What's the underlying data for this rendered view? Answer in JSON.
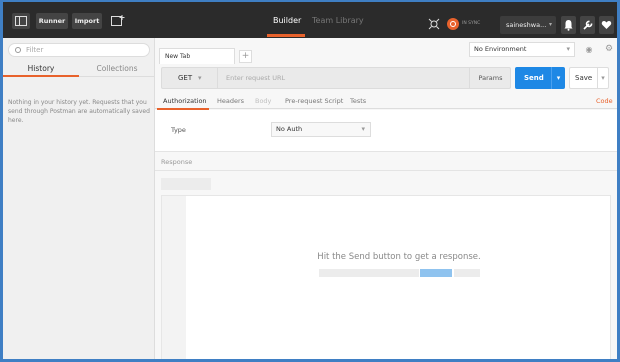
{
  "topbar": {
    "runner_label": "Runner",
    "import_label": "Import",
    "tabs": [
      {
        "label": "Builder",
        "active": true
      },
      {
        "label": "Team Library",
        "active": false
      }
    ],
    "sync_label": "IN SYNC",
    "username": "saineshwa...",
    "accent_color": "#e8622c"
  },
  "sidebar": {
    "filter_placeholder": "Filter",
    "tabs": [
      {
        "label": "History",
        "active": true
      },
      {
        "label": "Collections",
        "active": false
      }
    ],
    "empty_message": "Nothing in your history yet. Requests that you send through Postman are automatically saved here."
  },
  "main": {
    "request_tab_label": "New Tab",
    "add_tab_label": "+",
    "environment": "No Environment",
    "method": "GET",
    "url_placeholder": "Enter request URL",
    "params_label": "Params",
    "send_label": "Send",
    "save_label": "Save",
    "subtabs": [
      {
        "label": "Authorization",
        "state": "active"
      },
      {
        "label": "Headers",
        "state": "normal"
      },
      {
        "label": "Body",
        "state": "disabled"
      },
      {
        "label": "Pre-request Script",
        "state": "normal"
      },
      {
        "label": "Tests",
        "state": "normal"
      }
    ],
    "code_link": "Code",
    "auth": {
      "type_label": "Type",
      "type_value": "No Auth"
    },
    "response": {
      "label": "Response",
      "message": "Hit the Send button to get a response."
    },
    "send_color": "#1e88e5"
  }
}
